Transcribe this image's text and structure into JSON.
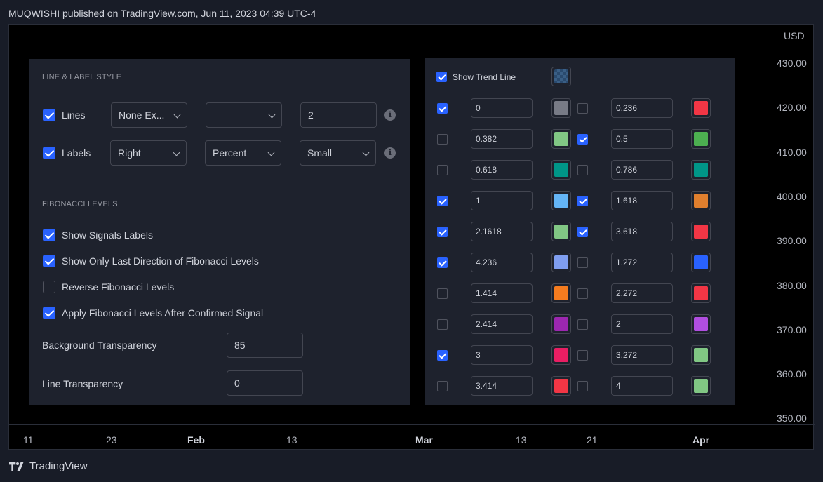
{
  "header": {
    "publish_text": "MUQWISHI published on TradingView.com, Jun 11, 2023 04:39 UTC-4"
  },
  "footer": {
    "brand": "TradingView"
  },
  "chart": {
    "currency": "USD",
    "price_labels": [
      "430.00",
      "420.00",
      "410.00",
      "400.00",
      "390.00",
      "380.00",
      "370.00",
      "360.00",
      "350.00"
    ],
    "time_labels": [
      {
        "text": "11",
        "bold": false
      },
      {
        "text": "23",
        "bold": false
      },
      {
        "text": "Feb",
        "bold": true
      },
      {
        "text": "13",
        "bold": false
      },
      {
        "text": "Mar",
        "bold": true
      },
      {
        "text": "13",
        "bold": false
      },
      {
        "text": "21",
        "bold": false
      },
      {
        "text": "Apr",
        "bold": true
      }
    ]
  },
  "style": {
    "section_title": "LINE & LABEL STYLE",
    "lines": {
      "label": "Lines",
      "checked": true,
      "select1": "None Ex...",
      "select2": "",
      "width": "2"
    },
    "labels": {
      "label": "Labels",
      "checked": true,
      "select1": "Right",
      "select2": "Percent",
      "select3": "Small"
    },
    "info_glyph": "i"
  },
  "fib": {
    "section_title": "FIBONACCI LEVELS",
    "options": [
      {
        "label": "Show Signals Labels",
        "checked": true
      },
      {
        "label": "Show Only Last Direction of Fibonacci Levels",
        "checked": true
      },
      {
        "label": "Reverse Fibonacci Levels",
        "checked": false
      },
      {
        "label": "Apply Fibonacci Levels After Confirmed Signal",
        "checked": true
      }
    ],
    "bg_transparency_label": "Background Transparency",
    "bg_transparency_value": "85",
    "line_transparency_label": "Line Transparency",
    "line_transparency_value": "0"
  },
  "trend": {
    "label": "Show Trend Line",
    "checked": true
  },
  "levels": [
    {
      "l": {
        "checked": true,
        "value": "0",
        "color": "#787b86"
      },
      "r": {
        "checked": false,
        "value": "0.236",
        "color": "#f23645"
      }
    },
    {
      "l": {
        "checked": false,
        "value": "0.382",
        "color": "#81c784"
      },
      "r": {
        "checked": true,
        "value": "0.5",
        "color": "#4caf50"
      }
    },
    {
      "l": {
        "checked": false,
        "value": "0.618",
        "color": "#009688"
      },
      "r": {
        "checked": false,
        "value": "0.786",
        "color": "#009688"
      }
    },
    {
      "l": {
        "checked": true,
        "value": "1",
        "color": "#64b5f6"
      },
      "r": {
        "checked": true,
        "value": "1.618",
        "color": "#e07f2e"
      }
    },
    {
      "l": {
        "checked": true,
        "value": "2.1618",
        "color": "#81c784"
      },
      "r": {
        "checked": true,
        "value": "3.618",
        "color": "#f23645"
      }
    },
    {
      "l": {
        "checked": true,
        "value": "4.236",
        "color": "#7f9ef0"
      },
      "r": {
        "checked": false,
        "value": "1.272",
        "color": "#2962ff"
      }
    },
    {
      "l": {
        "checked": false,
        "value": "1.414",
        "color": "#f57c1f"
      },
      "r": {
        "checked": false,
        "value": "2.272",
        "color": "#f23645"
      }
    },
    {
      "l": {
        "checked": false,
        "value": "2.414",
        "color": "#9c27b0"
      },
      "r": {
        "checked": false,
        "value": "2",
        "color": "#b04ee0"
      }
    },
    {
      "l": {
        "checked": true,
        "value": "3",
        "color": "#e91e63"
      },
      "r": {
        "checked": false,
        "value": "3.272",
        "color": "#81c784"
      }
    },
    {
      "l": {
        "checked": false,
        "value": "3.414",
        "color": "#f23645"
      },
      "r": {
        "checked": false,
        "value": "4",
        "color": "#81c784"
      }
    }
  ]
}
